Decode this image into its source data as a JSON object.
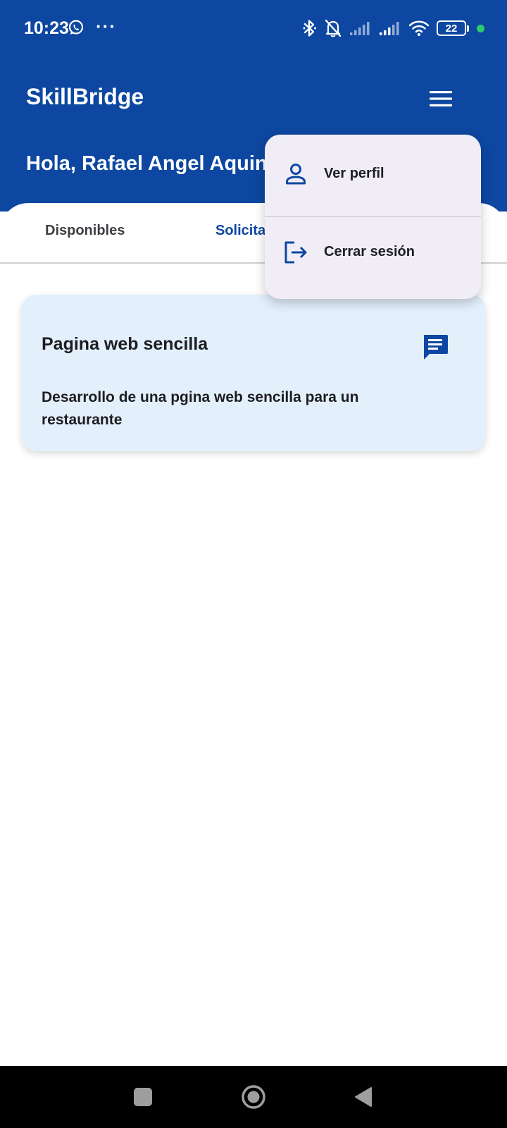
{
  "status_bar": {
    "time": "10:23",
    "more_indicator": "···",
    "battery": "22",
    "icons": [
      "whatsapp-icon",
      "bluetooth-icon",
      "bell-off-icon",
      "signal-icon",
      "signal-icon",
      "wifi-icon",
      "battery-icon"
    ]
  },
  "app": {
    "title": "SkillBridge",
    "greeting": "Hola, Rafael Angel Aquino",
    "menu_icon": "hamburger-menu-icon"
  },
  "tabs": [
    {
      "label": "Disponibles",
      "active": false
    },
    {
      "label": "Solicitados",
      "active": true
    }
  ],
  "cards": [
    {
      "title": "Pagina web sencilla",
      "description": "Desarrollo de una pgina web sencilla para un restaurante",
      "icon": "chat-icon"
    }
  ],
  "menu": {
    "items": [
      {
        "label": "Ver perfil",
        "icon": "person-icon"
      },
      {
        "label": "Cerrar sesión",
        "icon": "logout-icon"
      }
    ]
  },
  "colors": {
    "primary": "#0d47a1",
    "card_bg": "#e3f0fc",
    "menu_bg": "#f1edf6",
    "status_dot": "#2ecc71"
  },
  "nav_bar": {
    "buttons": [
      "recent-apps-icon",
      "home-icon",
      "back-icon"
    ]
  }
}
